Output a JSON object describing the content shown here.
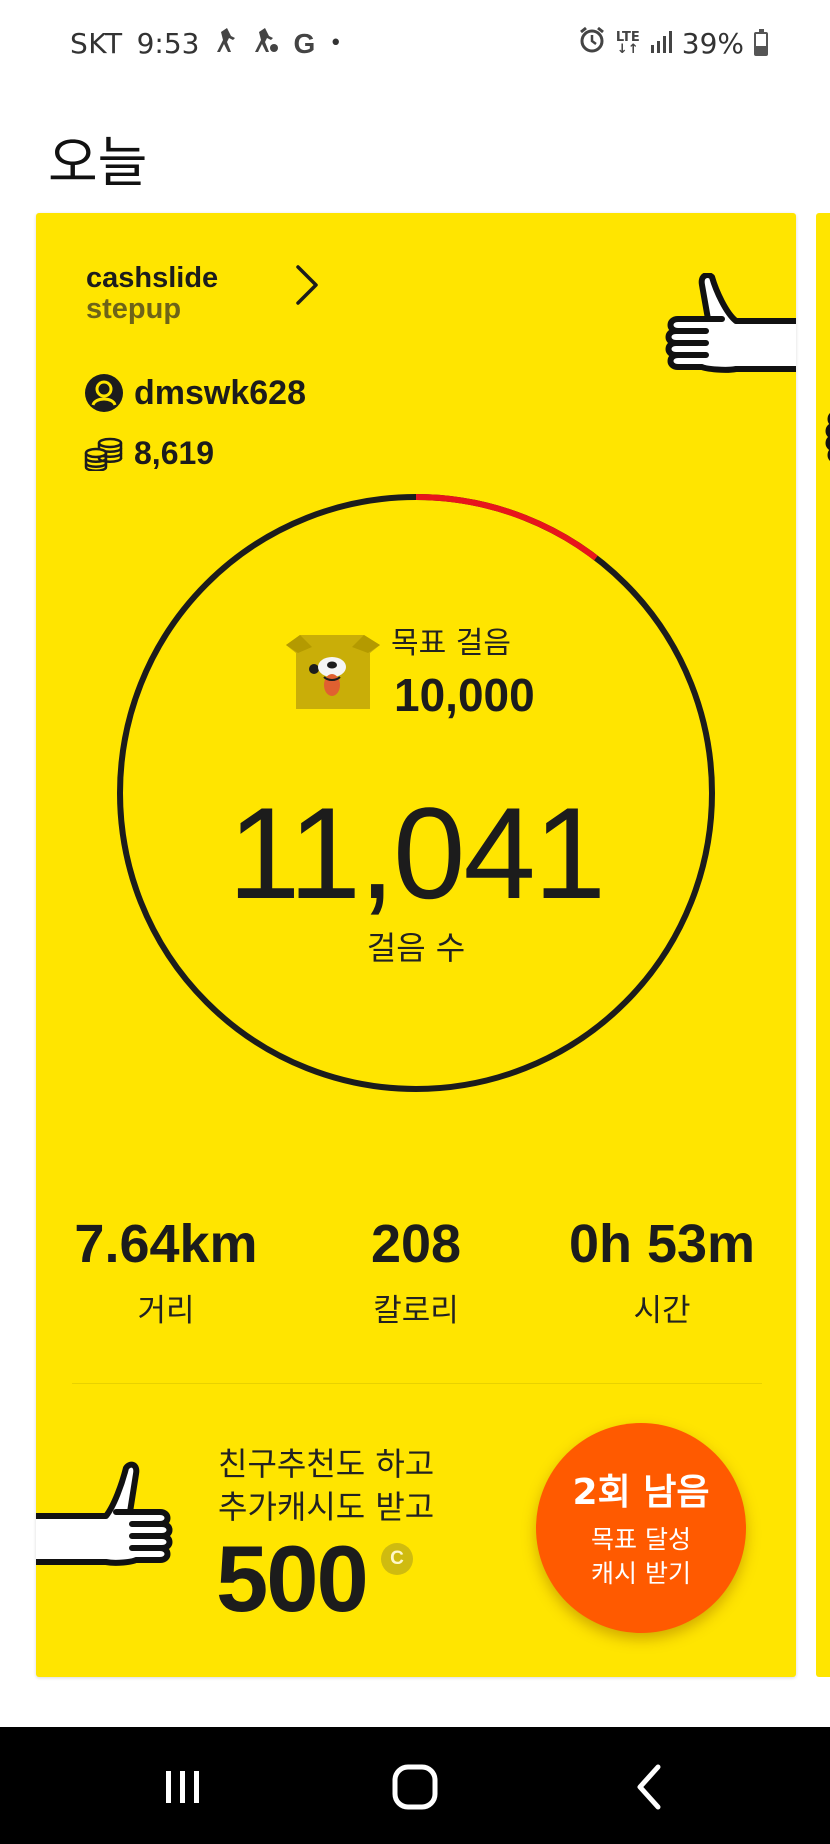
{
  "status_bar": {
    "carrier": "SKT",
    "time": "9:53",
    "google_glyph": "G",
    "dot": "•",
    "network": "LTE",
    "battery": "39%"
  },
  "page": {
    "title": "오늘"
  },
  "card": {
    "brand_line1": "cashslide",
    "brand_line2": "stepup",
    "username": "dmswk628",
    "coins": "8,619",
    "goal_label": "목표 걸음",
    "goal_value": "10,000",
    "steps": "11,041",
    "steps_label": "걸음 수",
    "goal_progress_fraction_shown": 0.104,
    "stats": [
      {
        "value": "7.64km",
        "label": "거리"
      },
      {
        "value": "208",
        "label": "칼로리"
      },
      {
        "value": "0h 53m",
        "label": "시간"
      }
    ],
    "promo": {
      "line1": "친구추천도 하고",
      "line2": "추가캐시도 받고",
      "amount": "500",
      "coin_symbol": "C"
    },
    "reward_button": {
      "count": "2회 남음",
      "line1": "목표 달성",
      "line2": "캐시 받기"
    }
  },
  "colors": {
    "card_bg": "#ffe500",
    "ring": "#1c1c1c",
    "ring_accent": "#e8151b",
    "reward_button": "#ff5a00"
  },
  "icons": {
    "user": "user-circle-icon",
    "coins": "coin-stack-icon",
    "chevron": "chevron-right-icon",
    "alarm": "alarm-icon",
    "signal": "signal-icon",
    "battery": "battery-icon"
  }
}
